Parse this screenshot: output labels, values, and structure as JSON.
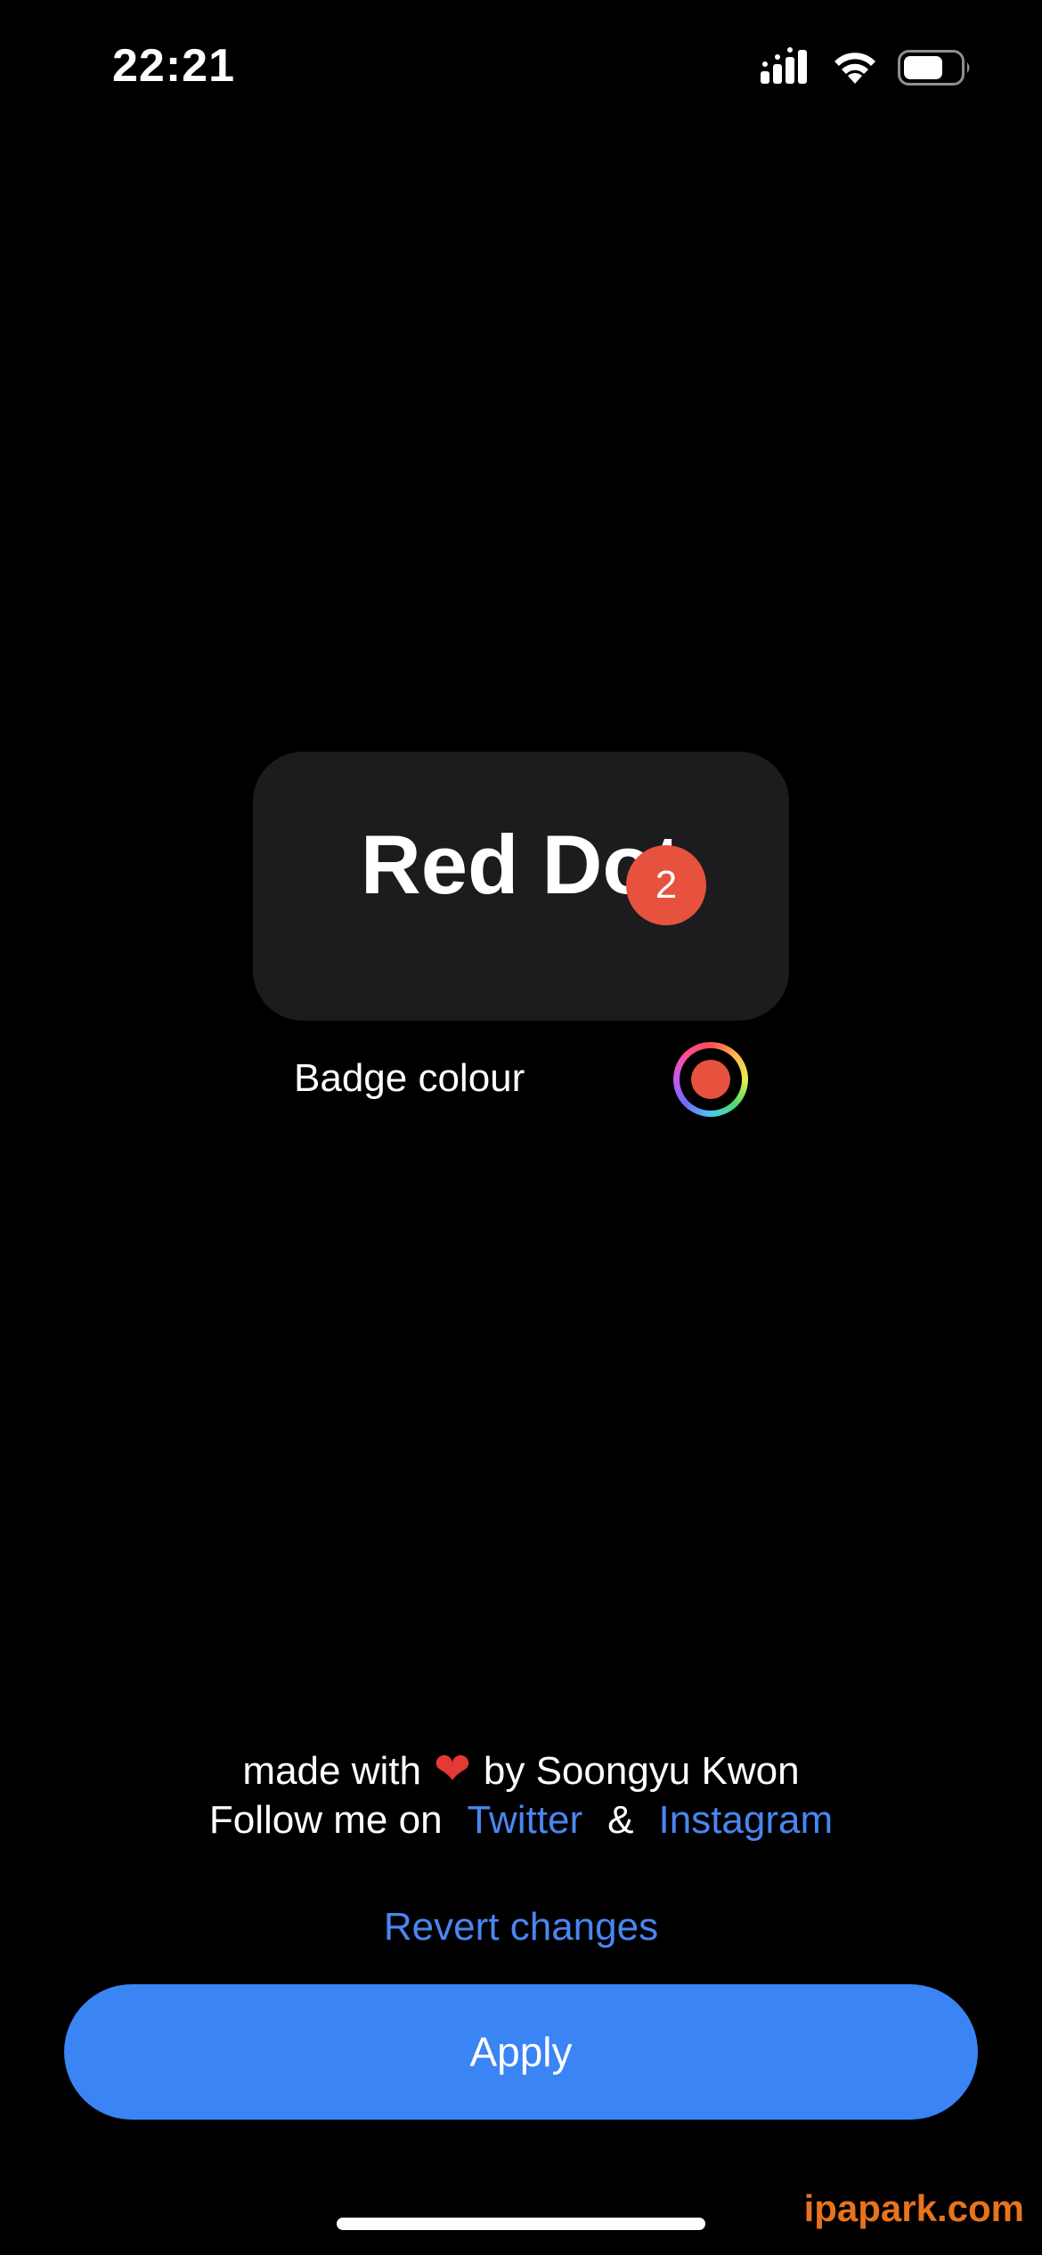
{
  "status_bar": {
    "time": "22:21",
    "icons": [
      "signal-icon",
      "wifi-icon",
      "battery-icon"
    ],
    "battery_level": 0.7
  },
  "preview": {
    "title": "Red Dot",
    "badge_count": "2",
    "badge_color": "#e6523e"
  },
  "badge_colour": {
    "label": "Badge colour",
    "selected_color": "#e6523e"
  },
  "credits": {
    "made_with": "made with",
    "heart": "❤",
    "by": "by Soongyu Kwon",
    "follow_prefix": "Follow me on",
    "twitter": "Twitter",
    "ampersand": "&",
    "instagram": "Instagram"
  },
  "actions": {
    "revert": "Revert changes",
    "apply": "Apply"
  },
  "watermark": "ipapark.com",
  "colors": {
    "background": "#000000",
    "card": "#1c1c1e",
    "accent": "#3a84f4",
    "link": "#4a86f0"
  }
}
